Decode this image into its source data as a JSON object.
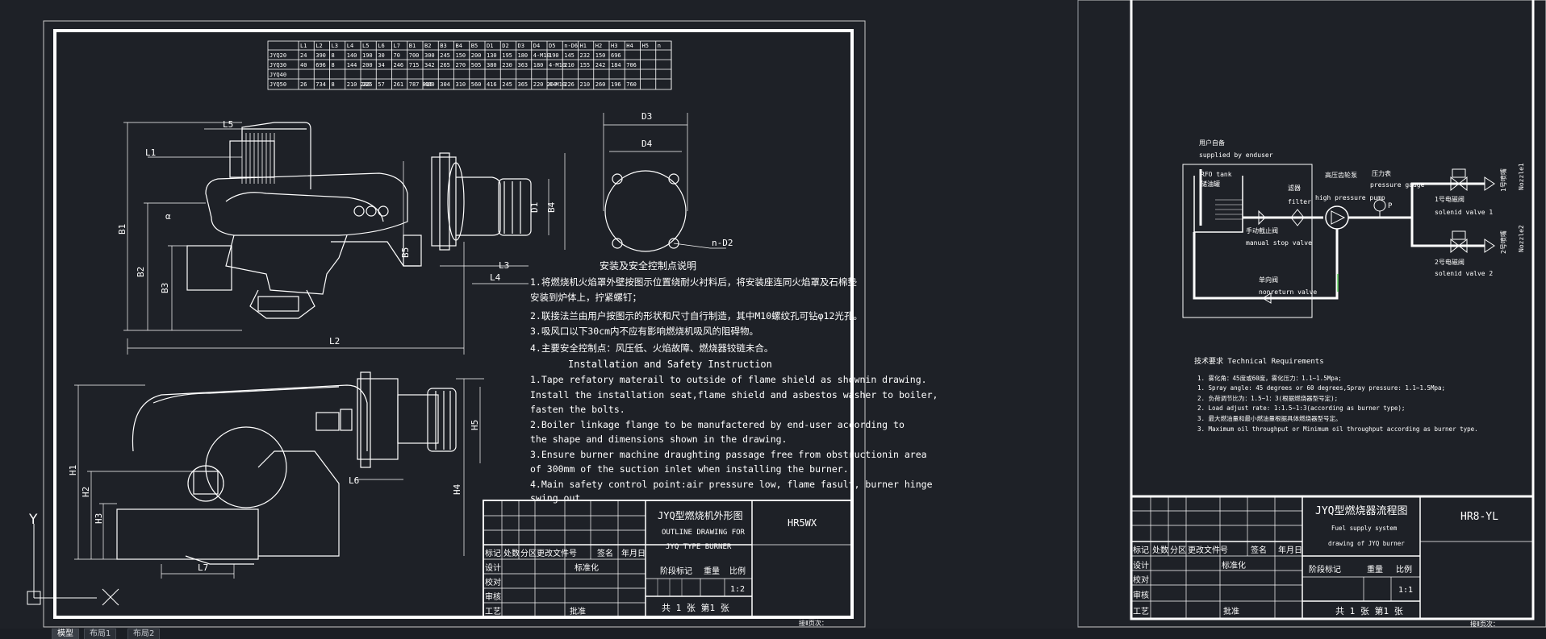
{
  "sheet1": {
    "table": {
      "headers": [
        "L1",
        "L2",
        "L3",
        "L4",
        "L5",
        "L6",
        "L7",
        "B1",
        "B2",
        "B3",
        "B4",
        "B5",
        "D1",
        "D2",
        "D3",
        "D4",
        "D5",
        "n-D6",
        "H1",
        "H2",
        "H3",
        "H4",
        "H5",
        "n"
      ],
      "rows": [
        {
          "model": "JYQ20",
          "values": [
            "24",
            "390",
            "8",
            "140",
            "190",
            "30",
            "70",
            "700",
            "300",
            "245",
            "150",
            "200",
            "130",
            "195",
            "180",
            "4-M10",
            "190",
            "145",
            "232",
            "150",
            "696",
            "",
            ""
          ]
        },
        {
          "model": "JYQ30",
          "values": [
            "40",
            "696",
            "8",
            "144",
            "200",
            "34",
            "246",
            "715",
            "342",
            "265",
            "270",
            "505",
            "380",
            "230",
            "363",
            "180",
            "4-M10",
            "210",
            "155",
            "242",
            "184",
            "706",
            ""
          ]
        },
        {
          "model": "JYQ40",
          "values": [
            "",
            "",
            "",
            "",
            "",
            "",
            "",
            "",
            "",
            "",
            "",
            "",
            "",
            "",
            "",
            "",
            "",
            "",
            "",
            "",
            "",
            "",
            ""
          ]
        },
        {
          "model": "JYQ50",
          "values": [
            "26",
            "734",
            "8",
            "210 280",
            "225",
            "57",
            "261",
            "787 815",
            "400",
            "304",
            "310",
            "560",
            "416",
            "245",
            "365",
            "220 260",
            "4-M10",
            "226",
            "210",
            "260",
            "196",
            "760"
          ]
        }
      ]
    },
    "dims": {
      "l5": "L5",
      "l1": "L1",
      "b1": "B1",
      "b2": "B2",
      "b3": "B3",
      "b4": "B4",
      "b5": "B5",
      "l2": "L2",
      "l3": "L3",
      "l4": "L4",
      "d1": "D1",
      "d3": "D3",
      "d4": "D4",
      "nd2": "n-D2",
      "h1": "H1",
      "h2": "H2",
      "h3": "H3",
      "h4": "H4",
      "h5": "H5",
      "l7": "L7",
      "l6": "L6",
      "alpha": "α"
    },
    "notes_cn": {
      "title": "安装及安全控制点说明",
      "lines": [
        "1.将燃烧机火焰罩外壁按图示位置绕耐火衬料后，将安装座连同火焰罩及石棉垫",
        "安装到炉体上，拧紧螺钉；",
        "2.联接法兰由用户按图示的形状和尺寸自行制造，其中M10螺纹孔可钻φ12光孔。",
        "3.吸风口以下30cm内不应有影响燃烧机吸风的阻碍物。",
        "4.主要安全控制点：风压低、火焰故障、燃烧器铰链未合。"
      ]
    },
    "notes_en": {
      "title": "Installation and Safety Instruction",
      "lines": [
        "1.Tape refatory materail to outside of flame shield as shownin drawing.",
        "Install the installation seat,flame shield and asbestos washer to boiler,",
        "fasten the bolts.",
        "2.Boiler linkage flange to be manufactered by end-user according to",
        "the shape and dimensions shown in the drawing.",
        "3.Ensure burner machine draughting passage free from obstructionin area",
        "of 300mm of the suction inlet when installing the burner.",
        "4.Main safety control point:air pressure low, flame fasult, burner hinge",
        "swing out."
      ]
    },
    "title_block": {
      "title_cn": "JYQ型燃烧机外形图",
      "title_en1": "OUTLINE DRAWING FOR",
      "title_en2": "JYQ TYPE BURNER",
      "drawing_no": "HR5WX",
      "rev_headers": [
        "标记",
        "处数",
        "分区",
        "更改文件号",
        "签名",
        "年月日"
      ],
      "roles": [
        "设计",
        "校对",
        "审核",
        "工艺"
      ],
      "std": "标准化",
      "approve": "批准",
      "stage": "阶段标记",
      "weight": "重量",
      "scale_label": "比例",
      "scale": "1:2",
      "sheets": "共 1 张  第1 张",
      "corner": "接Ⅱ页次："
    },
    "ucs": {
      "y": "Y"
    }
  },
  "sheet2": {
    "supplied_cn": "用户自备",
    "supplied_en": "supplied by enduser",
    "tank_cn": "储油罐",
    "tank_en": "RFO tank",
    "filter_cn": "滤器",
    "filter_en": "filter",
    "pump_cn": "高压齿轮泵",
    "pump_en": "high pressure pump",
    "gauge_cn": "压力表",
    "gauge_en": "pressure gauge",
    "gauge_symbol": "P",
    "sv1_cn": "1号电磁阀",
    "sv1_en": "solenid valve 1",
    "sv2_cn": "2号电磁阀",
    "sv2_en": "solenid valve 2",
    "nozzle1_cn": "1号喷嘴",
    "nozzle1_en": "Nozzle1",
    "nozzle2_cn": "2号喷嘴",
    "nozzle2_en": "Nozzle2",
    "stop_cn": "手动截止阀",
    "stop_en": "manual stop valve",
    "check_cn": "单向阀",
    "check_en": "nonreturn valve",
    "req_title": "技术要求 Technical Requirements",
    "req_lines": [
      "1. 雾化角：45度或60度，雾化压力：1.1~1.5Mpa;",
      "1. Spray angle: 45 degrees or 60 degrees,Spray pressure: 1.1~1.5Mpa;",
      "2. 负荷调节比为：1.5~1：3(根据燃烧器型号定);",
      "2. Load adjust rate: 1:1.5~1:3(according as burner type);",
      "3. 最大燃油量和最小燃油量根据具体燃烧器型号定。",
      "3. Maximum oil throughput or Minimum oil throughput according as burner type."
    ],
    "title_block": {
      "title_cn": "JYQ型燃烧器流程图",
      "title_en1": "Fuel supply system",
      "title_en2": "drawing of JYQ burner",
      "drawing_no": "HR8-YL",
      "rev_headers": [
        "标记",
        "处数",
        "分区",
        "更改文件号",
        "签名",
        "年月日"
      ],
      "roles": [
        "设计",
        "校对",
        "审核",
        "工艺"
      ],
      "std": "标准化",
      "approve": "批准",
      "stage": "阶段标记",
      "weight": "重量",
      "scale_label": "比例",
      "scale": "1:1",
      "sheets": "共 1 张  第1 张",
      "corner": "接Ⅱ页次："
    }
  },
  "layout_tabs": [
    "模型",
    "布局1",
    "布局2"
  ],
  "colors": {
    "background": "#1e2127",
    "line": "#ffffff",
    "sheet_edge": "#3a3f47",
    "accent": "#5fd35f"
  }
}
